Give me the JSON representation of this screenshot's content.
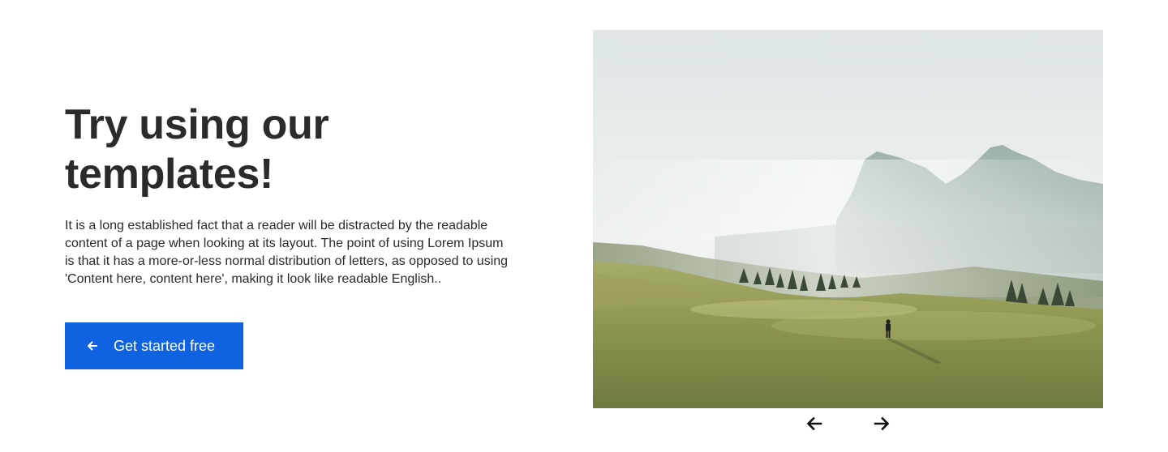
{
  "hero": {
    "title": "Try using our templates!",
    "description": "It is a long established fact that a reader will be distracted by the readable content of a page when looking at its layout. The point of using Lorem Ipsum is that it has a more-or-less normal distribution of letters, as opposed to using 'Content here, content here', making it look like readable English..",
    "cta_label": "Get started free",
    "cta_icon": "arrow-left-icon"
  },
  "carousel": {
    "image_subject": "hiker-in-misty-mountain-meadow",
    "prev_icon": "arrow-left-icon",
    "next_icon": "arrow-right-icon"
  },
  "colors": {
    "primary": "#0f62e0",
    "text": "#2b2b2b",
    "background": "#ffffff"
  }
}
